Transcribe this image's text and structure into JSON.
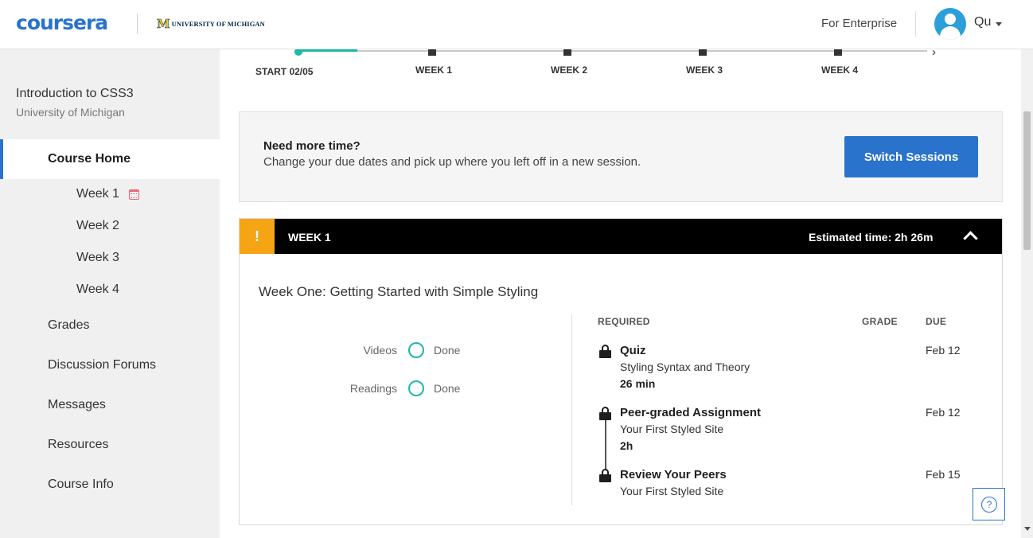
{
  "header": {
    "logo_text": "coursera",
    "partner_mark": "M",
    "partner_name": "UNIVERSITY OF MICHIGAN",
    "enterprise_link": "For Enterprise",
    "user_name": "Qu"
  },
  "sidebar": {
    "course_title": "Introduction to CSS3",
    "course_org": "University of Michigan",
    "home_label": "Course Home",
    "weeks": [
      "Week 1",
      "Week 2",
      "Week 3",
      "Week 4"
    ],
    "nav_items": [
      "Grades",
      "Discussion Forums",
      "Messages",
      "Resources",
      "Course Info"
    ]
  },
  "timeline": {
    "labels": [
      "START 02/05",
      "WEEK 1",
      "WEEK 2",
      "WEEK 3",
      "WEEK 4"
    ]
  },
  "session_banner": {
    "title": "Need more time?",
    "subtitle": "Change your due dates and pick up where you left off in a new session.",
    "button_label": "Switch Sessions"
  },
  "week_card": {
    "alert_glyph": "!",
    "label": "WEEK 1",
    "estimated_time": "Estimated time: 2h 26m",
    "heading": "Week One: Getting Started with Simple Styling",
    "progress": [
      {
        "label": "Videos",
        "status": "Done"
      },
      {
        "label": "Readings",
        "status": "Done"
      }
    ],
    "columns": {
      "required": "REQUIRED",
      "grade": "GRADE",
      "due": "DUE"
    },
    "items": [
      {
        "type": "Quiz",
        "name": "Styling Syntax and Theory",
        "duration": "26 min",
        "due": "Feb 12"
      },
      {
        "type": "Peer-graded Assignment",
        "name": "Your First Styled Site",
        "duration": "2h",
        "due": "Feb 12"
      },
      {
        "type": "Review Your Peers",
        "name": "Your First Styled Site",
        "duration": "",
        "due": "Feb 15"
      }
    ]
  },
  "help": {
    "glyph": "?"
  },
  "colors": {
    "brand_blue": "#2a73cc",
    "teal": "#20b7a8",
    "alert_orange": "#f5a514"
  }
}
